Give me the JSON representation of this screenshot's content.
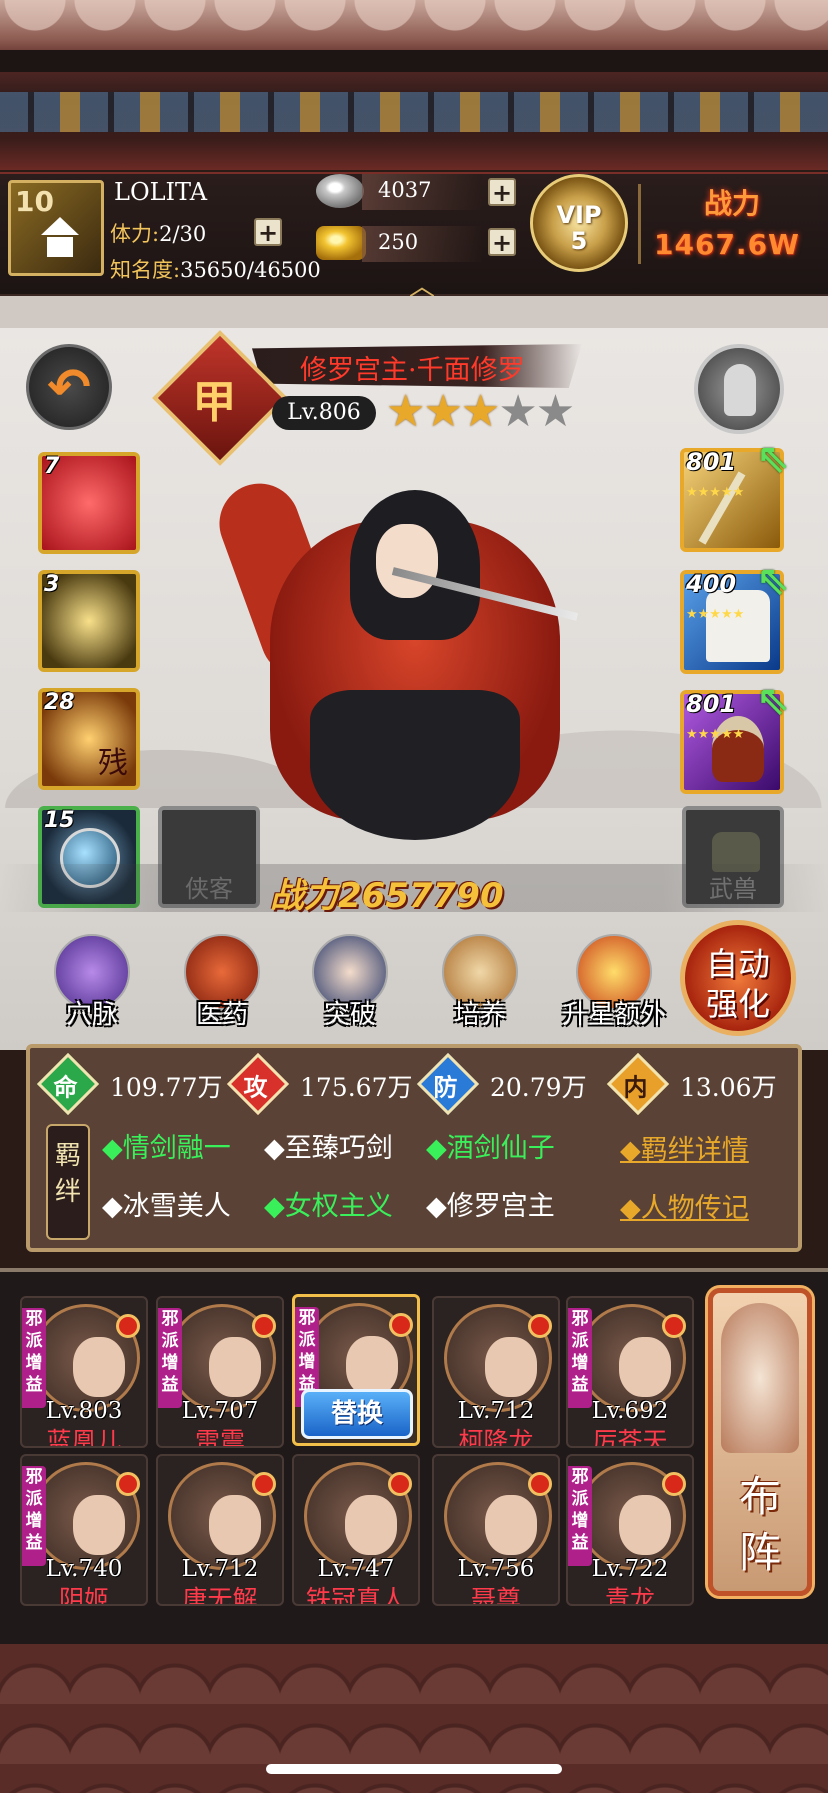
{
  "player": {
    "level": "10",
    "name": "LOLITA",
    "stamina_label": "体力:",
    "stamina_value": "2/30",
    "fame_label": "知名度:",
    "fame_value": "35650/46500"
  },
  "resources": {
    "silver": "4037",
    "gold": "250"
  },
  "vip": {
    "label": "VIP",
    "level": "5"
  },
  "top_power": {
    "label": "战力",
    "value": "1467.6W"
  },
  "hero": {
    "badge": "甲",
    "title": "修罗宫主·千面修罗",
    "level": "Lv.806",
    "stars_on": "★★★",
    "stars_off": "★★",
    "power": "战力2657790"
  },
  "skills": [
    {
      "count": "7"
    },
    {
      "count": "3"
    },
    {
      "count": "28",
      "glyph": "残"
    },
    {
      "count": "15"
    }
  ],
  "empty_slots": {
    "xiake": "侠客",
    "wushou": "武兽"
  },
  "equipment": [
    {
      "level": "801",
      "stars": "★★★★★"
    },
    {
      "level": "400",
      "stars": "★★★★★"
    },
    {
      "level": "801",
      "stars": "★★★★★"
    }
  ],
  "functions": [
    {
      "label": "穴脉"
    },
    {
      "label": "医药"
    },
    {
      "label": "突破"
    },
    {
      "label": "培养"
    },
    {
      "label": "升星额外"
    }
  ],
  "auto_enhance": {
    "line1": "自动",
    "line2": "强化"
  },
  "stats": [
    {
      "key": "命",
      "value": "109.77万"
    },
    {
      "key": "攻",
      "value": "175.67万"
    },
    {
      "key": "防",
      "value": "20.79万"
    },
    {
      "key": "内",
      "value": "13.06万"
    }
  ],
  "bonds_badge": {
    "c1": "羁",
    "c2": "绊"
  },
  "bonds": [
    "◆情剑融一",
    "◆至臻巧剑",
    "◆酒剑仙子",
    "◆冰雪美人",
    "◆女权主义",
    "◆修罗宫主"
  ],
  "bond_links": {
    "detail": "◆羁绊详情",
    "bio": "◆人物传记"
  },
  "lineup_tag": {
    "c1": "邪",
    "c2": "派",
    "c3": "增",
    "c4": "益"
  },
  "lineup": [
    {
      "level": "Lv.803",
      "name": "蓝凰儿"
    },
    {
      "level": "Lv.707",
      "name": "雷震"
    },
    {
      "swap": "替换"
    },
    {
      "level": "Lv.712",
      "name": "柯降龙"
    },
    {
      "level": "Lv.692",
      "name": "厉苍天"
    },
    {
      "level": "Lv.740",
      "name": "阴姬"
    },
    {
      "level": "Lv.712",
      "name": "唐无解"
    },
    {
      "level": "Lv.747",
      "name": "铁冠真人"
    },
    {
      "level": "Lv.756",
      "name": "聂尊"
    },
    {
      "level": "Lv.722",
      "name": "青龙"
    }
  ],
  "formation": {
    "c1": "布",
    "c2": "阵"
  },
  "colors": {
    "accent": "#e8a92a",
    "power": "#f5c13a",
    "danger": "#ff3a4a",
    "bond_green": "#3af05a"
  }
}
